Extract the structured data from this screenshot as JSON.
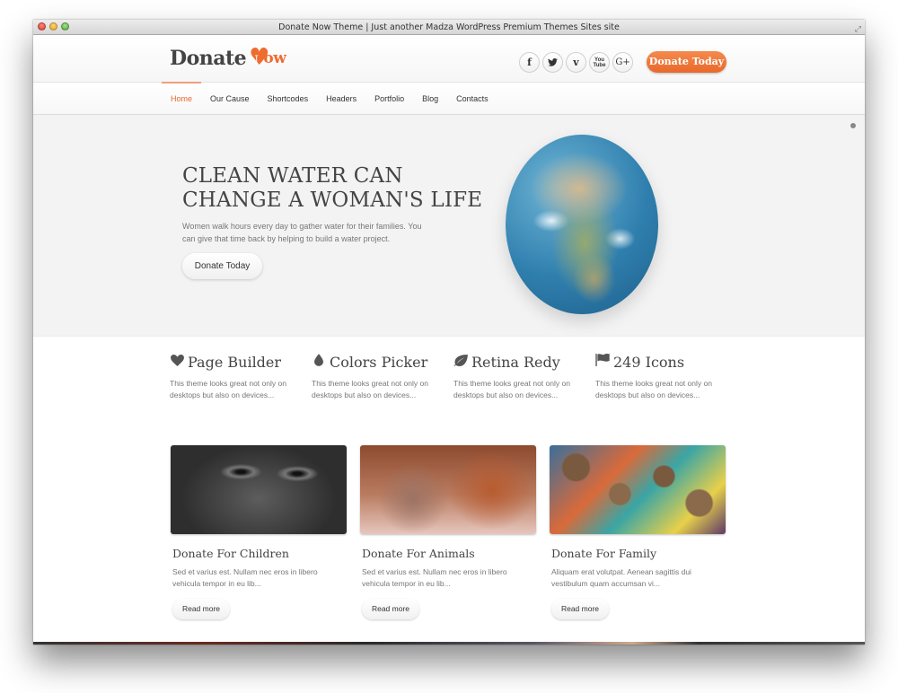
{
  "window": {
    "title": "Donate Now Theme | Just another Madza WordPress Premium Themes Sites site"
  },
  "header": {
    "logo_main": "Donate",
    "logo_accent_letter": "N",
    "logo_accent_rest": "ow",
    "socials": [
      {
        "name": "facebook",
        "glyph": "f"
      },
      {
        "name": "twitter",
        "glyph": "🐦"
      },
      {
        "name": "vimeo",
        "glyph": "v"
      },
      {
        "name": "youtube",
        "glyph": "You Tube"
      },
      {
        "name": "google-plus",
        "glyph": "G+"
      }
    ],
    "donate_button": "Donate Today"
  },
  "nav": {
    "items": [
      {
        "label": "Home",
        "active": true
      },
      {
        "label": "Our Cause",
        "active": false
      },
      {
        "label": "Shortcodes",
        "active": false
      },
      {
        "label": "Headers",
        "active": false
      },
      {
        "label": "Portfolio",
        "active": false
      },
      {
        "label": "Blog",
        "active": false
      },
      {
        "label": "Contacts",
        "active": false
      }
    ]
  },
  "hero": {
    "title_line1": "CLEAN WATER CAN",
    "title_line2": "CHANGE A WOMAN'S LIFE",
    "text": "Women walk hours every day to gather water for their families. You can give that time back by helping to build a water project.",
    "button": "Donate Today"
  },
  "features": [
    {
      "icon": "♥",
      "title": "Page Builder",
      "text": "This theme looks great not only on desktops but also on devices..."
    },
    {
      "icon": "💧",
      "title": "Colors Picker",
      "text": "This theme looks great not only on desktops but also on devices..."
    },
    {
      "icon": "🍃",
      "title": "Retina Redy",
      "text": "This theme looks great not only on desktops but also on devices..."
    },
    {
      "icon": "⚑",
      "title": "249 Icons",
      "text": "This theme looks great not only on desktops but also on devices..."
    }
  ],
  "cards": [
    {
      "title": "Donate For Children",
      "text": "Sed et varius est. Nullam nec eros in libero vehicula tempor in eu lib...",
      "button": "Read more"
    },
    {
      "title": "Donate For Animals",
      "text": "Sed et varius est. Nullam nec eros in libero vehicula tempor in eu lib...",
      "button": "Read more"
    },
    {
      "title": "Donate For Family",
      "text": "Aliquam erat volutpat. Aenean sagittis dui vestibulum quam accumsan vi...",
      "button": "Read more"
    }
  ],
  "colors": {
    "accent": "#e8692b",
    "text": "#444444",
    "muted": "#777777"
  }
}
